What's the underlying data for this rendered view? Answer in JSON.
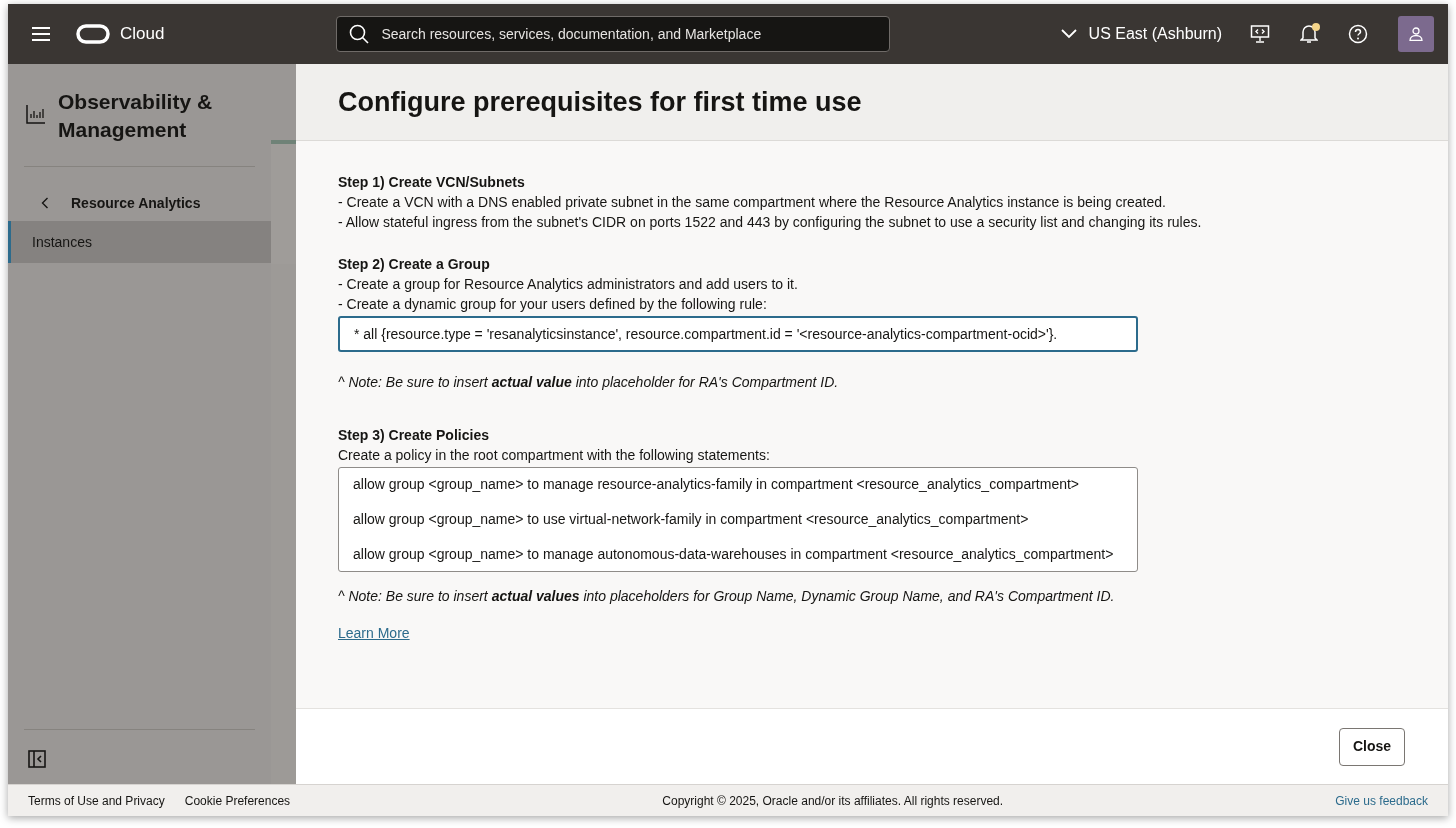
{
  "header": {
    "brand": "Cloud",
    "search": {
      "placeholder": "Search resources, services, documentation, and Marketplace"
    },
    "region": "US East (Ashburn)",
    "notification_dot": true
  },
  "sidebar": {
    "title": "Observability & Management",
    "back_link": "Resource Analytics",
    "items": [
      {
        "label": "Instances",
        "selected": true
      }
    ]
  },
  "dialog": {
    "title": "Configure prerequisites for first time use",
    "sections": [
      {
        "kind": "text",
        "heading": "Step 1) Create VCN/Subnets",
        "lines": [
          "- Create a VCN with a DNS enabled private subnet in the same compartment where the Resource Analytics instance is being created.",
          "- Allow stateful ingress from the subnet's CIDR on ports 1522 and 443 by configuring the subnet to use a security list and changing its rules."
        ]
      },
      {
        "kind": "rule",
        "heading": "Step 2) Create a Group",
        "lines": [
          "- Create a group for Resource Analytics administrators and add users to it.",
          "- Create a dynamic group for your users defined by the following rule:"
        ],
        "code": [
          "* all {resource.type = 'resanalyticsinstance', resource.compartment.id = '<resource-analytics-compartment-ocid>'}."
        ],
        "focused": true,
        "note": "^ Note: Be sure to insert **actual value** into placeholder for RA's Compartment ID."
      },
      {
        "kind": "policies",
        "heading": "Step 3) Create Policies",
        "lines": [
          "Create a policy in the root compartment with the following statements:"
        ],
        "code": [
          "allow group <group_name> to manage resource-analytics-family in compartment <resource_analytics_compartment>",
          "allow group <group_name> to use virtual-network-family in compartment <resource_analytics_compartment>",
          "allow group <group_name> to manage autonomous-data-warehouses in compartment <resource_analytics_compartment>"
        ],
        "focused": false,
        "note": "^ Note: Be sure to insert **actual values** into placeholders for Group Name, Dynamic Group Name, and RA's Compartment ID."
      }
    ],
    "link": "Learn More",
    "close_button": "Close"
  },
  "footer": {
    "links": [
      "Terms of Use and Privacy",
      "Cookie Preferences"
    ],
    "copyright": "Copyright © 2025, Oracle and/or its affiliates. All rights reserved.",
    "feedback": "Give us feedback"
  }
}
